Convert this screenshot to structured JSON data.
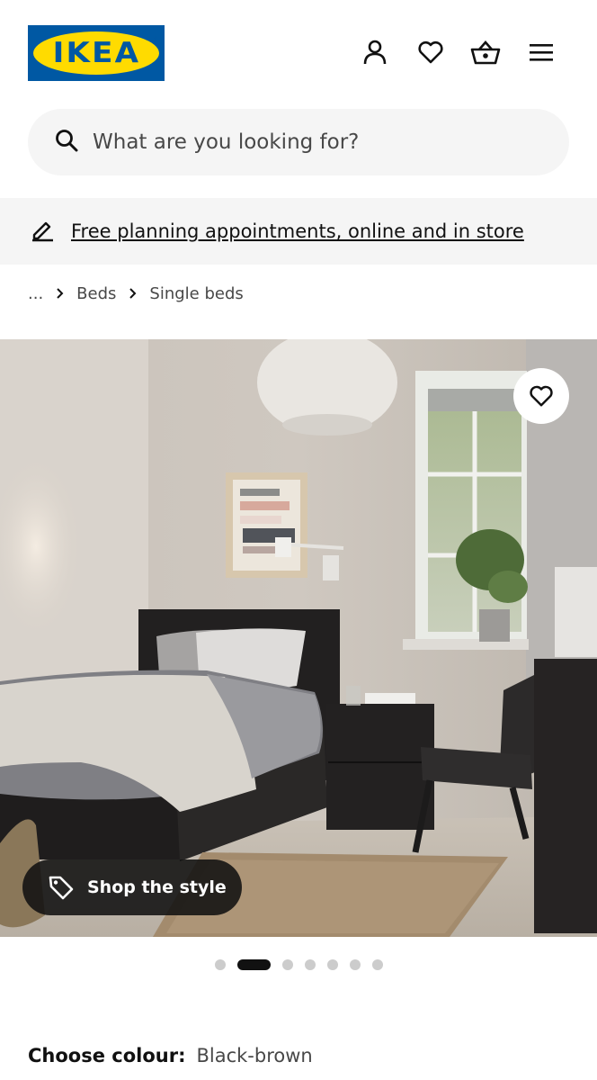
{
  "header": {
    "logo_text": "IKEA",
    "logo_registered": "®",
    "icons": [
      "profile-icon",
      "heart-icon",
      "basket-icon",
      "menu-icon"
    ]
  },
  "search": {
    "placeholder": "What are you looking for?"
  },
  "banner": {
    "text": "Free planning appointments, online and in store",
    "icon": "pencil-icon"
  },
  "breadcrumb": {
    "ellipsis": "...",
    "items": [
      "Beds",
      "Single beds"
    ]
  },
  "gallery": {
    "shop_the_style": "Shop the style",
    "slide_count": 7,
    "active_slide": 2
  },
  "product": {
    "colour_label": "Choose colour:",
    "colour_value": "Black-brown"
  },
  "colors": {
    "brand_blue": "#0058a3",
    "brand_yellow": "#ffdb00",
    "search_bg": "#f5f5f5",
    "dot_active": "#111111",
    "dot_inactive": "#cccccc"
  }
}
